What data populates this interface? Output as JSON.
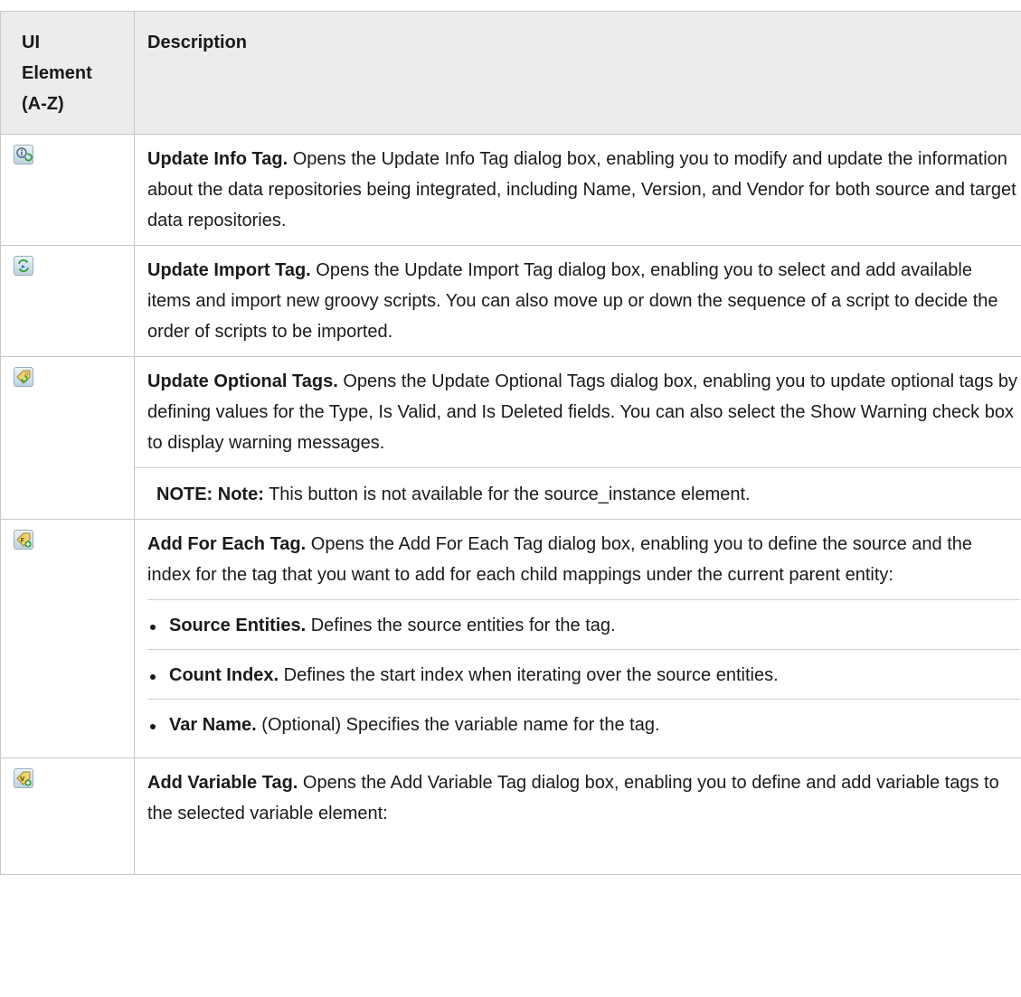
{
  "table": {
    "headers": {
      "ui_element_line1": "UI",
      "ui_element_line2": "Element",
      "ui_element_line3": "(A-Z)",
      "description": "Description"
    },
    "rows": [
      {
        "icon": "update-info-tag-icon",
        "title": "Update Info Tag.",
        "text": " Opens the Update Info Tag dialog box, enabling you to modify and update the information about the data repositories being integrated, including Name, Version, and Vendor for both source and target data repositories."
      },
      {
        "icon": "update-import-tag-icon",
        "title": "Update Import Tag.",
        "text": " Opens the Update Import Tag dialog box, enabling you to select and add available items and import new groovy scripts. You can also move up or down the sequence of a script to decide the order of scripts to be imported."
      },
      {
        "icon": "update-optional-tags-icon",
        "title": "Update Optional Tags.",
        "text": " Opens the Update Optional Tags dialog box, enabling you to update optional tags by defining values for the Type, Is Valid, and Is Deleted fields. You can also select the Show Warning check box to display warning messages.",
        "note_label": "NOTE: Note:",
        "note_text": " This button is not available for the source_instance element."
      },
      {
        "icon": "add-for-each-tag-icon",
        "title": "Add For Each Tag.",
        "text": " Opens the Add For Each Tag dialog box, enabling you to define the source and the index for the tag that you want to add for each child mappings under the current parent entity:",
        "bullets": [
          {
            "label": "Source Entities.",
            "text": " Defines the source entities for the tag."
          },
          {
            "label": "Count Index.",
            "text": " Defines the start index when iterating over the source entities."
          },
          {
            "label": "Var Name.",
            "text": " (Optional) Specifies the variable name for the tag."
          }
        ]
      },
      {
        "icon": "add-variable-tag-icon",
        "title": "Add Variable Tag.",
        "text": " Opens the Add Variable Tag dialog box, enabling you to define and add variable tags to the selected variable element:"
      }
    ]
  }
}
